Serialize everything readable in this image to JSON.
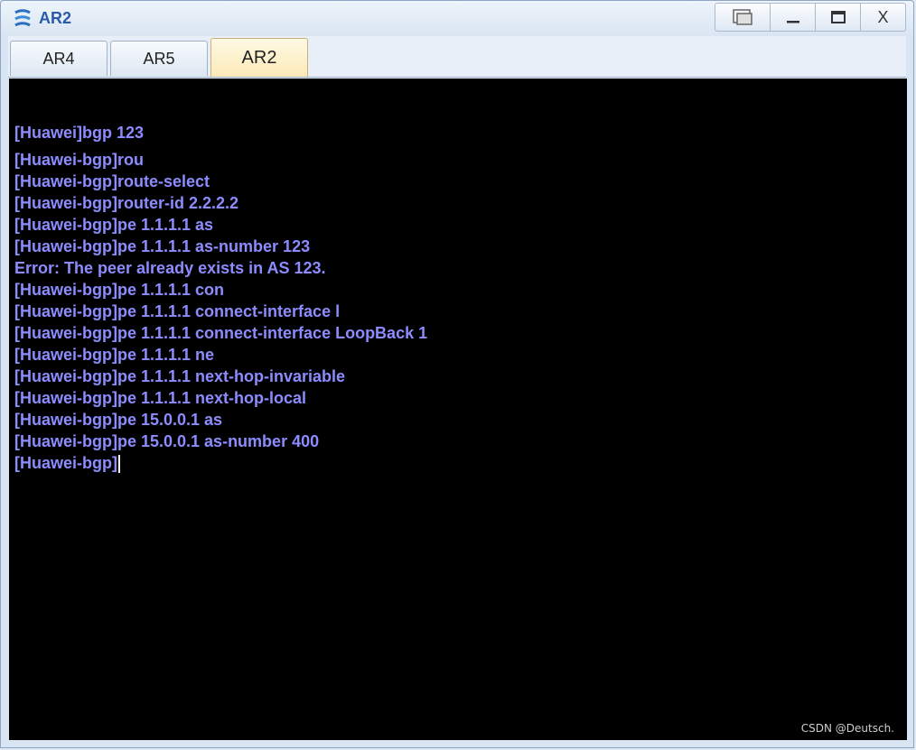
{
  "window": {
    "title": "AR2",
    "controls": [
      {
        "name": "restore-windows-icon",
        "glyph": "⧉"
      },
      {
        "name": "minimize-icon",
        "glyph": "—"
      },
      {
        "name": "maximize-icon",
        "glyph": "▭"
      },
      {
        "name": "close-icon",
        "glyph": "X"
      }
    ]
  },
  "tabs": [
    {
      "label": "AR4",
      "active": false
    },
    {
      "label": "AR5",
      "active": false
    },
    {
      "label": "AR2",
      "active": true
    }
  ],
  "terminal": {
    "lines": [
      "[Huawei]bgp 123",
      "[Huawei-bgp]rou",
      "[Huawei-bgp]route-select",
      "[Huawei-bgp]router-id 2.2.2.2",
      "[Huawei-bgp]pe 1.1.1.1 as",
      "[Huawei-bgp]pe 1.1.1.1 as-number 123",
      "Error: The peer already exists in AS 123.",
      "[Huawei-bgp]pe 1.1.1.1 con",
      "[Huawei-bgp]pe 1.1.1.1 connect-interface l",
      "[Huawei-bgp]pe 1.1.1.1 connect-interface LoopBack 1",
      "[Huawei-bgp]pe 1.1.1.1 ne",
      "[Huawei-bgp]pe 1.1.1.1 next-hop-invariable",
      "[Huawei-bgp]pe 1.1.1.1 next-hop-local",
      "[Huawei-bgp]pe 15.0.0.1 as",
      "[Huawei-bgp]pe 15.0.0.1 as-number 400"
    ],
    "prompt": "[Huawei-bgp]",
    "text_color": "#8c8cff",
    "background": "#000000"
  },
  "watermark": "CSDN @Deutsch."
}
